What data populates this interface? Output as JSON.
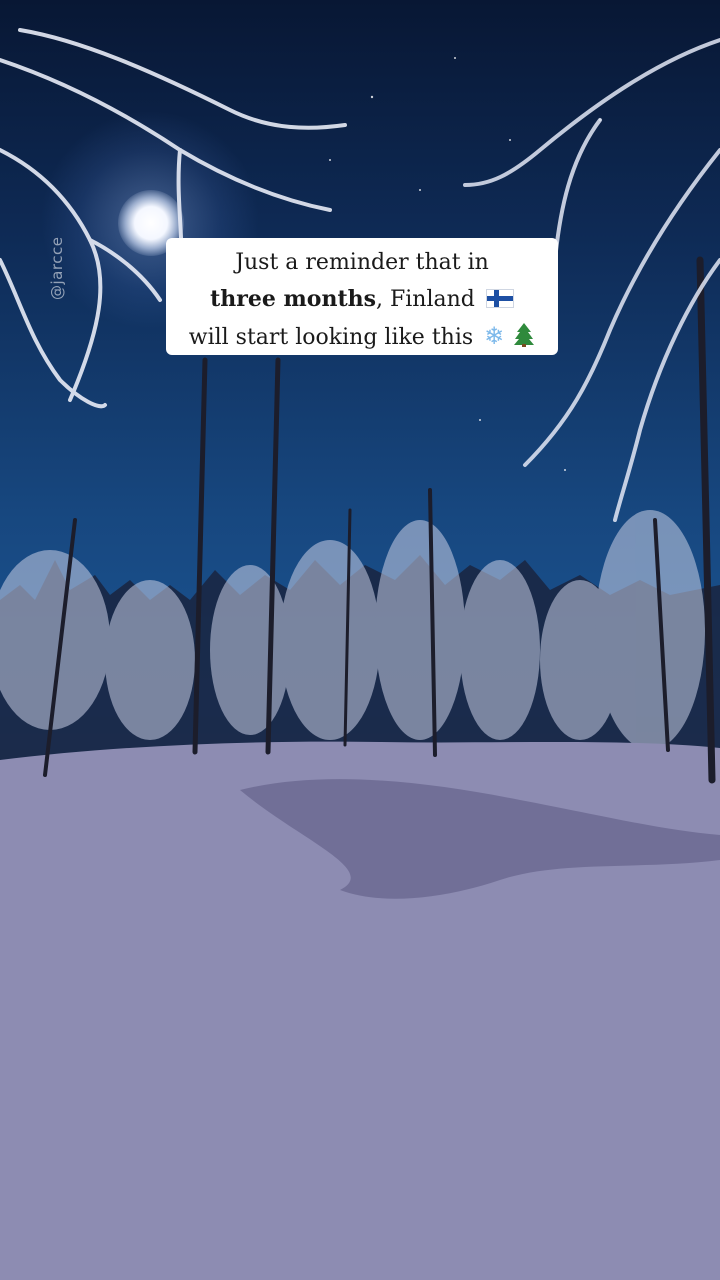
{
  "watermark": "@jarcce",
  "caption": {
    "line1": "Just a reminder that in",
    "line2_bold": "three months",
    "line2_rest": ", Finland",
    "line3": "will start looking like this"
  },
  "icons": {
    "flag": "finland-flag-icon",
    "snowflake": "snowflake-icon",
    "tree": "evergreen-tree-icon"
  },
  "colors": {
    "sky_top": "#081734",
    "sky_mid": "#1b5593",
    "snow": "#8f8fb5",
    "caption_bg": "#ffffff"
  }
}
